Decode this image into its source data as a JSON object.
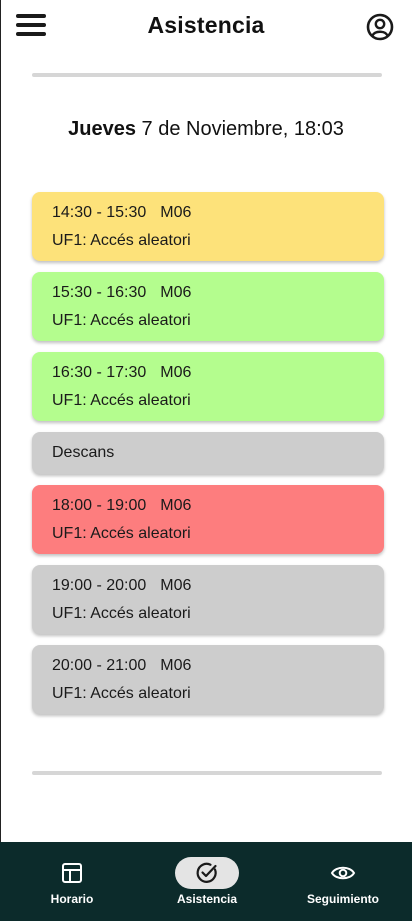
{
  "header": {
    "title": "Asistencia",
    "menu_icon": "hamburger-menu-icon",
    "profile_icon": "account-circle-icon"
  },
  "date": {
    "weekday": "Jueves",
    "rest": "7 de Noviembre, 18:03"
  },
  "colors": {
    "yellow": "#fde27a",
    "green": "#b4fd8e",
    "red": "#fd7d7e",
    "grey": "#cdcdcd",
    "nav_bg": "#0c2b2b"
  },
  "sessions": [
    {
      "time": "14:30 - 15:30",
      "module": "M06",
      "unit": "UF1: Accés aleatori",
      "status": "yellow"
    },
    {
      "time": "15:30 - 16:30",
      "module": "M06",
      "unit": "UF1: Accés aleatori",
      "status": "green"
    },
    {
      "time": "16:30 - 17:30",
      "module": "M06",
      "unit": "UF1: Accés aleatori",
      "status": "green"
    },
    {
      "label": "Descans",
      "status": "grey"
    },
    {
      "time": "18:00 - 19:00",
      "module": "M06",
      "unit": "UF1: Accés aleatori",
      "status": "red"
    },
    {
      "time": "19:00 - 20:00",
      "module": "M06",
      "unit": "UF1: Accés aleatori",
      "status": "grey"
    },
    {
      "time": "20:00 - 21:00",
      "module": "M06",
      "unit": "UF1: Accés aleatori",
      "status": "grey"
    }
  ],
  "nav": [
    {
      "label": "Horario",
      "icon": "calendar-table-icon",
      "active": false
    },
    {
      "label": "Asistencia",
      "icon": "check-circle-icon",
      "active": true
    },
    {
      "label": "Seguimiento",
      "icon": "eye-icon",
      "active": false
    }
  ]
}
